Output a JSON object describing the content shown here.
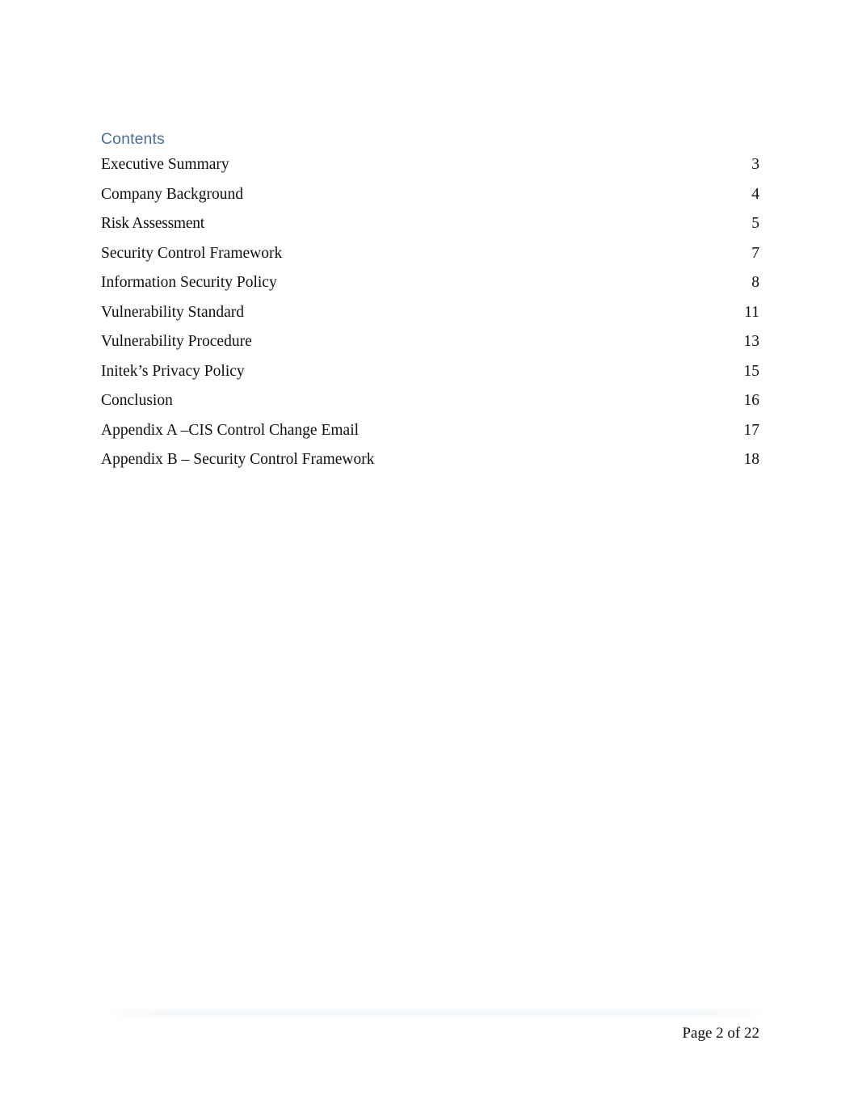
{
  "document": {
    "heading": "Contents",
    "heading_color": "#4a6f9e",
    "body_color": "#100f0d",
    "background_color": "#ffffff"
  },
  "toc": {
    "entries": [
      {
        "title": "Executive Summary",
        "page": "3"
      },
      {
        "title": "Company Background",
        "page": "4"
      },
      {
        "title": "Risk Assessment",
        "page": "5"
      },
      {
        "title": "Security Control Framework",
        "page": "7"
      },
      {
        "title": "Information Security Policy",
        "page": "8"
      },
      {
        "title": "Vulnerability Standard",
        "page": "11"
      },
      {
        "title": "Vulnerability Procedure",
        "page": "13"
      },
      {
        "title": "Initek’s Privacy Policy",
        "page": "15"
      },
      {
        "title": "Conclusion",
        "page": "16"
      },
      {
        "title": "Appendix A –CIS Control Change Email",
        "page": "17"
      },
      {
        "title": "Appendix B – Security Control Framework",
        "page": "18"
      }
    ]
  },
  "footer": {
    "page_label": "Page 2 of 22",
    "rule_color": "#eef2f6"
  }
}
